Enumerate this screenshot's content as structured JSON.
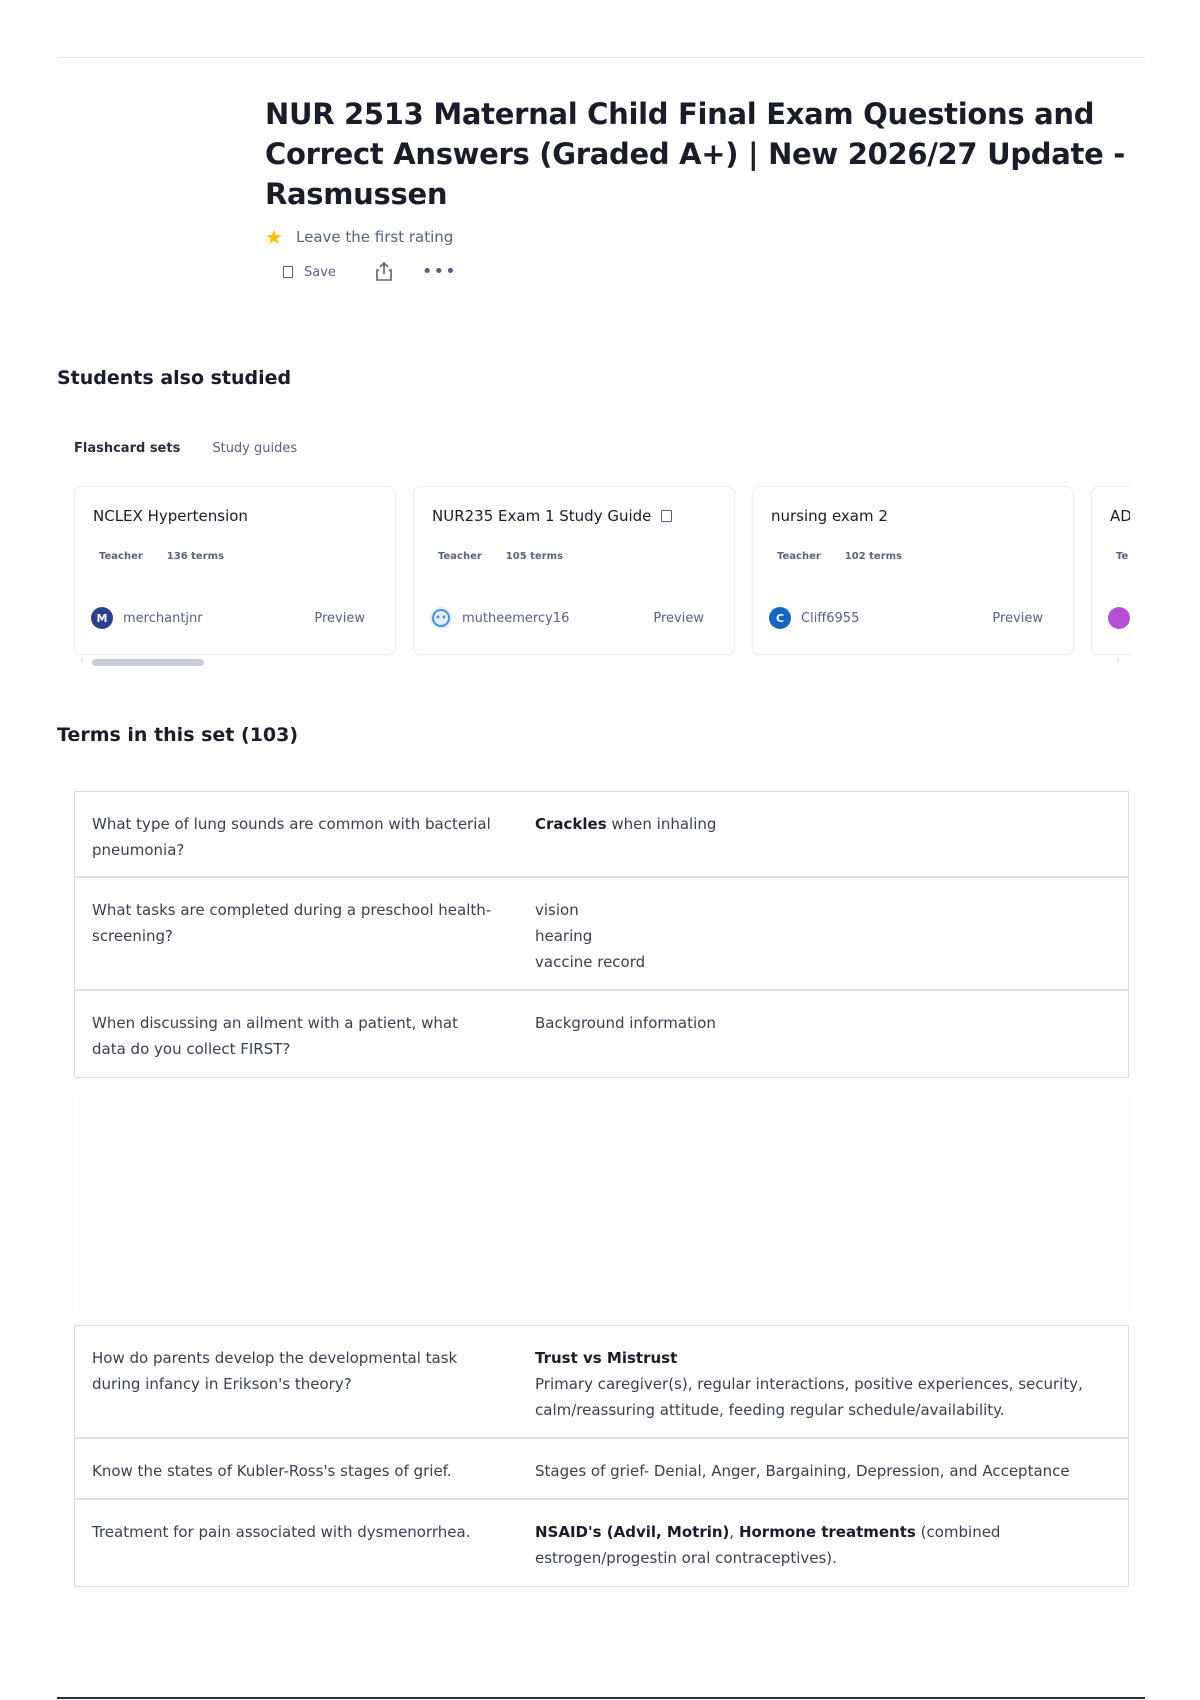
{
  "header": {
    "title": "NUR 2513 Maternal Child Final Exam Questions and Correct Answers (Graded A+) | New 2026/27 Update - Rasmussen",
    "rating_text": "Leave the first rating",
    "save_label": "Save"
  },
  "icons": {
    "star": "star-icon",
    "bookmark": "bookmark-icon",
    "share": "share-icon",
    "more": "more-icon"
  },
  "colors": {
    "star": "#ffbf00",
    "text": "#282e3e",
    "muted": "#586380",
    "border": "#d9dde4"
  },
  "also_studied": {
    "title": "Students also studied",
    "tabs": [
      "Flashcard sets",
      "Study guides"
    ],
    "cards": [
      {
        "title": "NCLEX Hypertension",
        "role": "Teacher",
        "terms": "136 terms",
        "author": "merchantjnr",
        "avatar_text": "M",
        "avatar_color": "#2a3f8f",
        "preview": "Preview",
        "guide_icon": false
      },
      {
        "title": "NUR235 Exam 1 Study Guide",
        "role": "Teacher",
        "terms": "105 terms",
        "author": "mutheemercy16",
        "avatar_text": "",
        "avatar_color": "#4a90e2",
        "preview": "Preview",
        "guide_icon": true
      },
      {
        "title": "nursing exam 2",
        "role": "Teacher",
        "terms": "102 terms",
        "author": "Cliff6955",
        "avatar_text": "C",
        "avatar_color": "#1565c0",
        "preview": "Preview",
        "guide_icon": false
      },
      {
        "title": "AD",
        "role": "Te",
        "terms": "",
        "author": "",
        "avatar_text": "",
        "avatar_color": "#b44fd6",
        "preview": "",
        "guide_icon": false
      }
    ]
  },
  "terms_set": {
    "title": "Terms in this set (103)",
    "group1": [
      {
        "q": "What type of lung sounds are common with bacterial pneumonia?",
        "a_bold": "Crackles",
        "a_rest": " when inhaling"
      },
      {
        "q": "What tasks are completed during a preschool health-screening?",
        "a_lines": [
          "vision",
          "hearing",
          "vaccine record"
        ]
      },
      {
        "q": "When discussing an ailment with a patient, what data do you collect FIRST?",
        "a_rest": "Background information"
      }
    ],
    "group2": [
      {
        "q": "How do parents develop the developmental task during infancy in Erikson's theory?",
        "a_bold": "Trust vs Mistrust",
        "a_rest": "Primary caregiver(s), regular interactions, positive experiences, security, calm/reassuring attitude, feeding regular schedule/availability.",
        "block": true
      },
      {
        "q": "Know the states of Kubler-Ross's stages of grief.",
        "a_rest": "Stages of grief- Denial, Anger, Bargaining, Depression, and Acceptance"
      },
      {
        "q": "Treatment for pain associated with dysmenorrhea.",
        "a_bold": "NSAID's (Advil, Motrin)",
        "a_mid": ", ",
        "a_bold2": "Hormone treatments",
        "a_rest": " (combined estrogen/progestin oral contraceptives)."
      }
    ]
  }
}
